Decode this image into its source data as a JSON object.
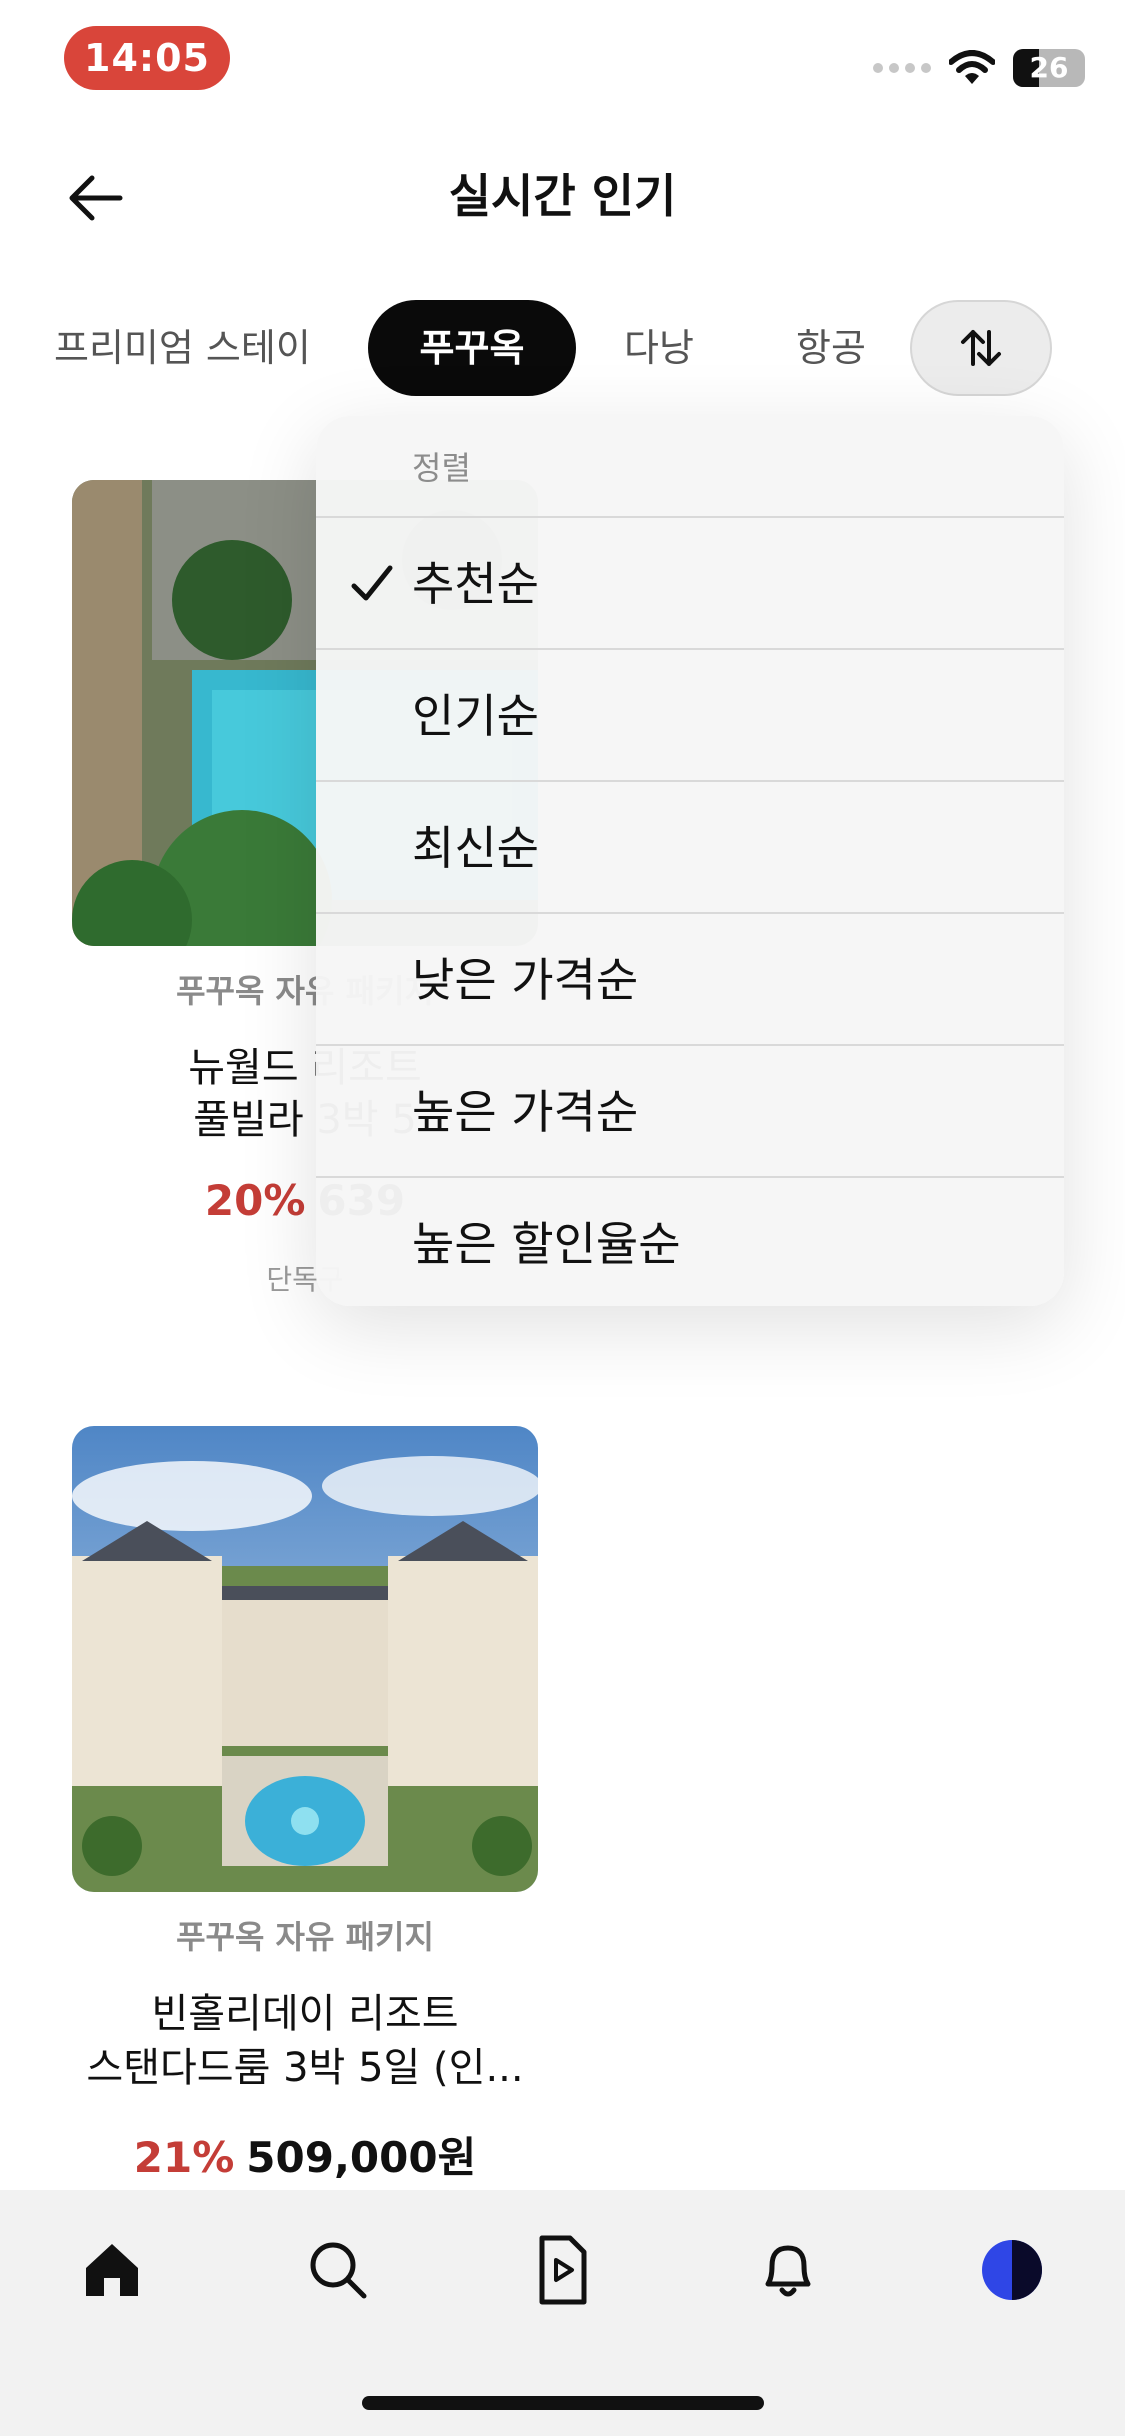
{
  "status_bar": {
    "time": "14:05",
    "battery": "26"
  },
  "header": {
    "title": "실시간 인기",
    "back_icon": "arrow-left-icon"
  },
  "tabs": [
    {
      "label": "프리미엄 스테이",
      "selected": false
    },
    {
      "label": "푸꾸옥",
      "selected": true
    },
    {
      "label": "다낭",
      "selected": false
    },
    {
      "label": "항공",
      "selected": false
    }
  ],
  "sort_button_icon": "sort-arrows-icon",
  "sort_menu": {
    "header": "정렬",
    "options": [
      {
        "label": "추천순",
        "checked": true
      },
      {
        "label": "인기순",
        "checked": false
      },
      {
        "label": "최신순",
        "checked": false
      },
      {
        "label": "낮은 가격순",
        "checked": false
      },
      {
        "label": "높은 가격순",
        "checked": false
      },
      {
        "label": "높은 할인율순",
        "checked": false
      }
    ]
  },
  "products": [
    {
      "category": "푸꾸옥 자유 패키지",
      "name_line1": "뉴월드 리조트",
      "name_line2": "풀빌라 3박 5",
      "discount": "20%",
      "price": "639",
      "note": "단독구"
    },
    {
      "category": "푸꾸옥 자유 패키지",
      "name_line1": "빈홀리데이 리조트",
      "name_line2": "스탠다드룸 3박 5일 (인...",
      "discount": "21%",
      "price": "509,000원"
    }
  ],
  "tabbar": [
    "home-icon",
    "search-icon",
    "video-icon",
    "bell-icon",
    "profile-avatar"
  ],
  "colors": {
    "accent_red": "#c43d37",
    "status_time_bg": "#d9453a",
    "selected_tab_bg": "#0a0a0a",
    "avatar_blue": "#2f46e6"
  }
}
